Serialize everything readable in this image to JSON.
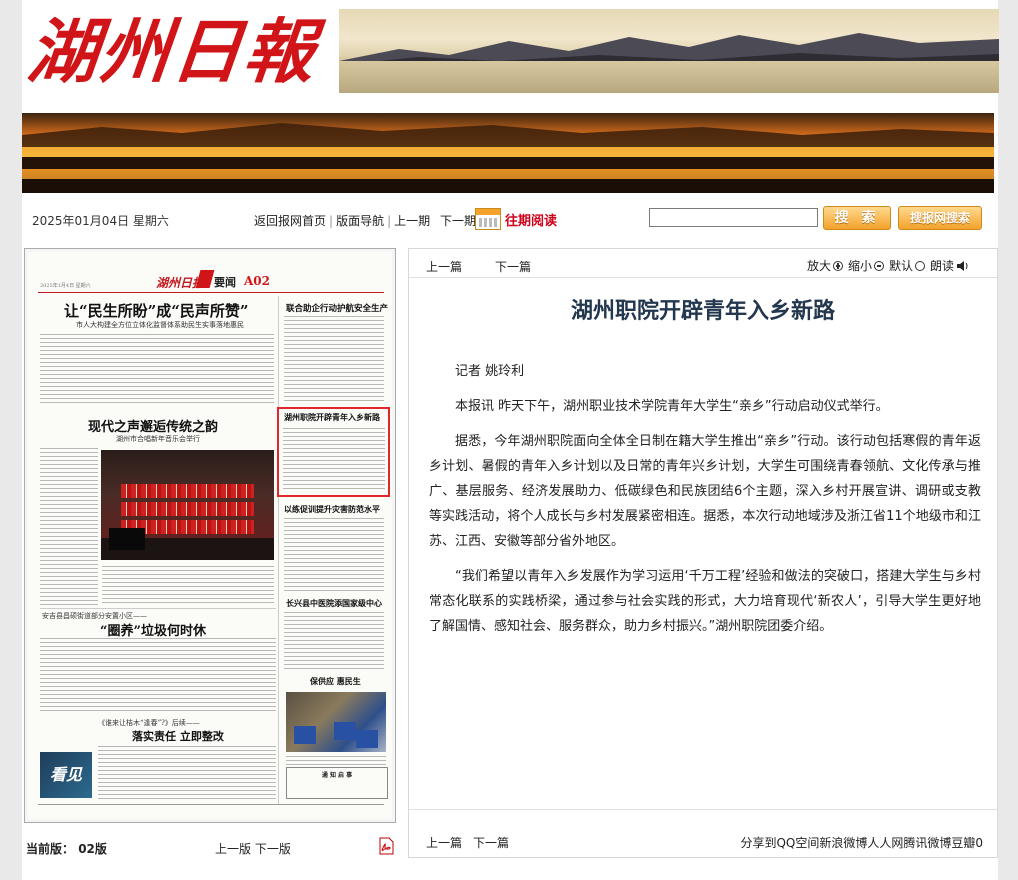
{
  "masthead": {
    "title": "湖州日報"
  },
  "navbar": {
    "date": "2025年01月04日 星期六",
    "home": "返回报网首页",
    "layout_nav": "版面导航",
    "prev_issue": "上一期",
    "next_issue": "下一期",
    "past_reading": "往期阅读",
    "search_value": "",
    "search_button": "搜 索",
    "net_search_button": "搜报网搜索"
  },
  "thumbnail": {
    "paper_logo": "湖州日报",
    "section": "要闻",
    "page_code": "A02",
    "date_line": "2025年1月4日 星期六",
    "headlines": {
      "h1": "让“民生所盼”成“民声所赞”",
      "h1_sub": "市人大构建全方位立体化监督体系助民生实事落地惠民",
      "h2": "联合助企行动护航安全生产",
      "h3": "现代之声邂逅传统之韵",
      "h3_sub": "湖州市合唱新年音乐会举行",
      "h4": "湖州职院开辟青年入乡新路",
      "h5": "以练促训提升灾害防范水平",
      "h6_kicker": "安吉县昌硕街道部分安置小区——",
      "h6": "“圈养”垃圾何时休",
      "h7": "长兴县中医院添国家级中心",
      "h8": "保供应 惠民生",
      "h9_kicker": "《谁来让桔木“逢春”?》后续——",
      "h9": "落实责任 立即整改",
      "notice": "通 知 启 事",
      "kanjian": "看见"
    }
  },
  "pager": {
    "current_label": "当前版：",
    "current_value": "02版",
    "prev_page": "上一版",
    "next_page": "下一版"
  },
  "article": {
    "top_prev": "上一篇",
    "top_next": "下一篇",
    "zoom_in": "放大",
    "zoom_out": "缩小",
    "default": "默认",
    "read_aloud": "朗读",
    "title": "湖州职院开辟青年入乡新路",
    "paragraphs": [
      "记者 姚玲利",
      "本报讯 昨天下午，湖州职业技术学院青年大学生“亲乡”行动启动仪式举行。",
      "据悉，今年湖州职院面向全体全日制在籍大学生推出“亲乡”行动。该行动包括寒假的青年返乡计划、暑假的青年入乡计划以及日常的青年兴乡计划，大学生可围绕青春领航、文化传承与推广、基层服务、经济发展助力、低碳绿色和民族团结6个主题，深入乡村开展宣讲、调研或支教等实践活动，将个人成长与乡村发展紧密相连。据悉，本次行动地域涉及浙江省11个地级市和江苏、江西、安徽等部分省外地区。",
      "“我们希望以青年入乡发展作为学习运用‘千万工程’经验和做法的突破口，搭建大学生与乡村常态化联系的实践桥梁，通过参与社会实践的形式，大力培育现代‘新农人’，引导大学生更好地了解国情、感知社会、服务群众，助力乡村振兴。”湖州职院团委介绍。"
    ],
    "bottom_prev": "上一篇",
    "bottom_next": "下一篇",
    "share": "分享到QQ空间新浪微博人人网腾讯微博豆瓣0"
  },
  "colors": {
    "brand_red": "#d01417",
    "title_blue": "#23374e",
    "highlight": "#e3262b"
  }
}
